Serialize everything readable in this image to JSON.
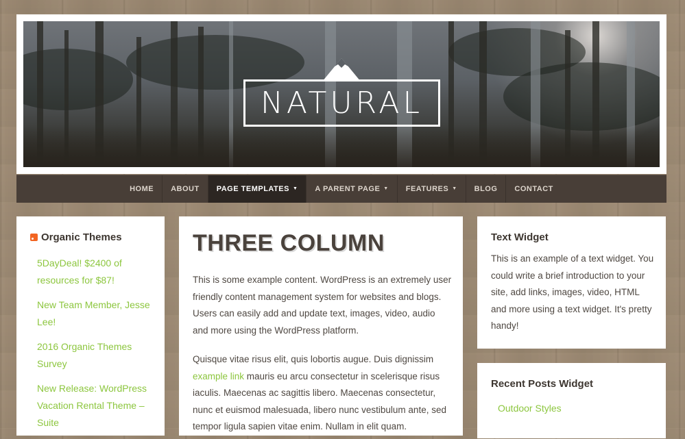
{
  "site": {
    "logo_text": "NATURAL"
  },
  "nav": {
    "items": [
      {
        "label": "HOME"
      },
      {
        "label": "ABOUT"
      },
      {
        "label": "PAGE TEMPLATES",
        "has_dropdown": true,
        "active": true
      },
      {
        "label": "A PARENT PAGE",
        "has_dropdown": true
      },
      {
        "label": "FEATURES",
        "has_dropdown": true
      },
      {
        "label": "BLOG"
      },
      {
        "label": "CONTACT"
      }
    ]
  },
  "left_sidebar": {
    "title": "Organic Themes",
    "icon": "rss-icon",
    "links": [
      "5DayDeal! $2400 of resources for $87!",
      "New Team Member, Jesse Lee!",
      "2016 Organic Themes Survey",
      "New Release: WordPress Vacation Rental Theme – Suite"
    ]
  },
  "main": {
    "title": "THREE COLUMN",
    "para1": "This is some example content. WordPress is an extremely user friendly content management system for websites and blogs. Users can easily add and update text, images, video, audio and more using the WordPress platform.",
    "para2_before": "Quisque vitae risus elit, quis lobortis augue. Duis dignissim ",
    "para2_link": "example link",
    "para2_after": " mauris eu arcu consectetur in scelerisque risus iaculis. Maecenas ac sagittis libero. Maecenas consectetur, nunc et euismod malesuada, libero nunc vestibulum ante, sed tempor ligula sapien vitae enim. Nullam in elit quam."
  },
  "right_sidebar": {
    "text_widget": {
      "title": "Text Widget",
      "body": "This is an example of a text widget. You could write a brief introduction to your site, add links, images, video, HTML and more using a text widget. It's pretty handy!"
    },
    "recent_posts": {
      "title": "Recent Posts Widget",
      "items": [
        "Outdoor Styles"
      ]
    }
  },
  "colors": {
    "accent_green": "#8cc63e",
    "nav_bg": "#483e37",
    "nav_active_bg": "#2c2622",
    "heading": "#4a423c",
    "body_bg": "#9e8b74"
  }
}
